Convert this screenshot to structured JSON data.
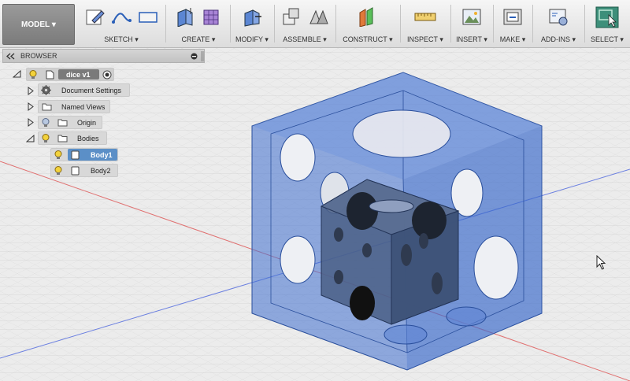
{
  "toolbar": {
    "mode": "MODEL",
    "groups": [
      "SKETCH",
      "CREATE",
      "MODIFY",
      "ASSEMBLE",
      "CONSTRUCT",
      "INSPECT",
      "INSERT",
      "MAKE",
      "ADD-INS",
      "SELECT"
    ],
    "dropdown_glyph": "▾"
  },
  "browser": {
    "title": "BROWSER",
    "root": "dice v1",
    "items": [
      "Document Settings",
      "Named Views",
      "Origin",
      "Bodies"
    ],
    "bodies": [
      "Body1",
      "Body2"
    ]
  },
  "colors": {
    "accent_blue": "#3f6fd0",
    "selected_body": "#5b8fc7",
    "bulb": "#f2d23c"
  }
}
